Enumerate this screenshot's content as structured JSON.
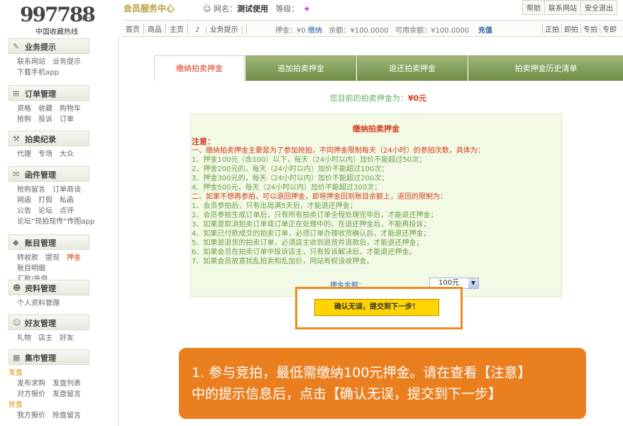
{
  "header": {
    "logo_number": "997788",
    "logo_suffix": ".com",
    "logo_subtitle": "中国收藏热线",
    "member_center": "会员服务中心",
    "user_label": "网名：",
    "user_name": "测试使用",
    "level_label": "等级：",
    "level_star": "★",
    "links": [
      "帮助",
      "联系网站",
      "安全退出"
    ]
  },
  "navbar": {
    "left_links": [
      "首页",
      "商品",
      "主页",
      "业务提示"
    ],
    "deposit_label": "押金：¥0",
    "pay_link": "缴纳",
    "balance_label": "余额：¥100.0000",
    "available_label": "可用余额：¥100.0000",
    "recharge": "充值",
    "right_links": [
      "正拍",
      "即拍",
      "专拍",
      "专即"
    ]
  },
  "sidebar": {
    "sections": [
      {
        "title": "业务提示",
        "icon": "pencil-icon",
        "rows": [
          [
            "联系网站",
            "业务提示"
          ],
          [
            "下载手机app"
          ]
        ]
      },
      {
        "title": "订单管理",
        "icon": "cart-icon",
        "rows": [
          [
            "资格",
            "收藏",
            "购物车"
          ],
          [
            "抢购",
            "投诉",
            "订单"
          ]
        ]
      },
      {
        "title": "拍卖纪录",
        "icon": "gavel-icon",
        "rows": [
          [
            "代理",
            "专场",
            "大众"
          ]
        ]
      },
      {
        "title": "函件管理",
        "icon": "envelope-icon",
        "rows": [
          [
            "抢购留言",
            "订单商谈"
          ],
          [
            "网函",
            "打假",
            "私函"
          ],
          [
            "公告",
            "论坛",
            "点评"
          ],
          [
            "论坛“现拍现传”传图app"
          ]
        ]
      },
      {
        "title": "账目管理",
        "icon": "diamond-icon",
        "rows": [
          [
            "转收款",
            "提现",
            "押金"
          ],
          [
            "账目明细",
            "汇款/充值"
          ]
        ]
      },
      {
        "title": "资料管理",
        "icon": "person-icon",
        "rows": [
          [
            "个人资料管理"
          ]
        ]
      },
      {
        "title": "好友管理",
        "icon": "friends-icon",
        "rows": [
          [
            "礼物",
            "店主",
            "好友"
          ]
        ]
      },
      {
        "title": "集市管理",
        "icon": "market-icon",
        "rows": [
          [
            "发盘"
          ],
          [
            "发布求购",
            "发盘列表"
          ],
          [
            "对方报价",
            "发盘留言"
          ],
          [
            "抢盘"
          ],
          [
            "我方报价",
            "抢盘留言"
          ]
        ]
      }
    ]
  },
  "tabs": [
    "缴纳拍卖押金",
    "追加拍卖押金",
    "退还拍卖押金",
    "拍卖押金历史清单"
  ],
  "balance_text": "您目前的拍卖押金为：",
  "balance_value": "¥0元",
  "box": {
    "title": "缴纳拍卖押金",
    "notice_heading": "注意：",
    "lines": [
      "一、缴纳拍卖押金主要是为了参加抢拍，不同押金限制每天（24小时）的参拍次数，具体为：",
      "1、押金100元（含100）以下，每天（24小时以内）加价不能超过50次；",
      "2、押金200元的，每天（24小时以内）加价不能超过100次；",
      "3、押金300元的，每天（24小时以内）加价不能超过200次；",
      "4、押金500元，每天（24小时以内）加价不能超过300次；",
      "二、如果不想再参拍，可以退回押金，即将押金回到账目余额上，退回的限制为：",
      "1、会员参拍后，只有出局满5天后，才能退还押金；",
      "2、会员参拍生成订单后，只有所有拍卖订单全程处理完毕后，才能退还押金；",
      "3、如果是取消拍卖订单或订单正在处理中的，在退还押金后，不能再投诉；",
      "4、如果已付款成交的拍卖订单，必须订单办理收货确认后，才能退还押金；",
      "5、如果是退货的拍卖订单，必须店主收到退货并退款后，才能退还押金；",
      "6、如果会员在拍卖订单中投诉店主，只有投诉解决后，才能退还押金。",
      "7、如果会员故意扰乱拍卖和乱加价，网站有权没收押金。"
    ],
    "amount_label": "押金金额：",
    "amount_value": "100元",
    "confirm_button": "确认无误，提交到下一步！"
  },
  "callout": {
    "line1": "1. 参与竞拍，最低需缴纳100元押金。请在查看【注意】",
    "line2": "中的提示信息后，点击【确认无误，提交到下一步】"
  },
  "colors": {
    "accent_red": "#d43b1e",
    "tab_green": "#7e9a53",
    "callout_orange": "#ea7f20",
    "button_yellow": "#ffd400"
  }
}
